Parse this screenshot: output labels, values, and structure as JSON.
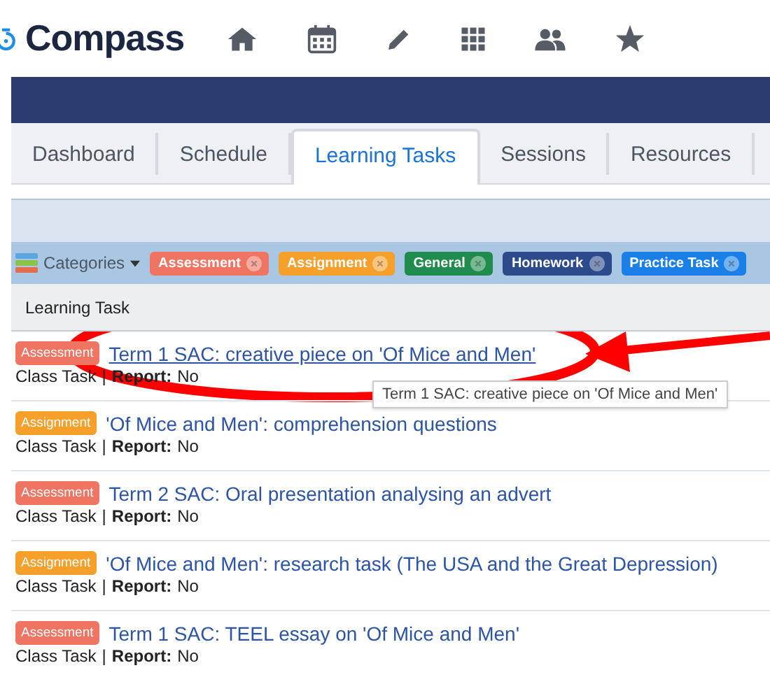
{
  "brand": {
    "name": "Compass"
  },
  "nav_icons": [
    {
      "kind": "home"
    },
    {
      "kind": "calendar"
    },
    {
      "kind": "pencil"
    },
    {
      "kind": "grid"
    },
    {
      "kind": "people"
    },
    {
      "kind": "star"
    }
  ],
  "tabs": [
    {
      "label": "Dashboard",
      "selected": false
    },
    {
      "label": "Schedule",
      "selected": false
    },
    {
      "label": "Learning Tasks",
      "selected": true
    },
    {
      "label": "Sessions",
      "selected": false
    },
    {
      "label": "Resources",
      "selected": false
    }
  ],
  "filter": {
    "label": "Categories",
    "tags": [
      {
        "label": "Assessment",
        "color": "#ef7462"
      },
      {
        "label": "Assignment",
        "color": "#f6a02c"
      },
      {
        "label": "General",
        "color": "#1f8b4c"
      },
      {
        "label": "Homework",
        "color": "#2d4a8c"
      },
      {
        "label": "Practice Task",
        "color": "#1a7fe6"
      }
    ]
  },
  "table": {
    "column": "Learning Task",
    "rows": [
      {
        "category": "Assessment",
        "color": "#ef7462",
        "title": "Term 1 SAC: creative piece on 'Of Mice and Men'",
        "type": "Class Task",
        "separator": "|",
        "report_label": "Report:",
        "report": "No",
        "hovered": true
      },
      {
        "category": "Assignment",
        "color": "#f6a02c",
        "title": "'Of Mice and Men': comprehension questions",
        "type": "Class Task",
        "separator": "|",
        "report_label": "Report:",
        "report": "No",
        "hovered": false
      },
      {
        "category": "Assessment",
        "color": "#ef7462",
        "title": "Term 2 SAC: Oral presentation analysing an advert",
        "type": "Class Task",
        "separator": "|",
        "report_label": "Report:",
        "report": "No",
        "hovered": false
      },
      {
        "category": "Assignment",
        "color": "#f6a02c",
        "title": "'Of Mice and Men': research task (The USA and the Great Depression)",
        "type": "Class Task",
        "separator": "|",
        "report_label": "Report:",
        "report": "No",
        "hovered": false
      },
      {
        "category": "Assessment",
        "color": "#ef7462",
        "title": "Term 1 SAC: TEEL essay on 'Of Mice and Men'",
        "type": "Class Task",
        "separator": "|",
        "report_label": "Report:",
        "report": "No",
        "hovered": false
      }
    ]
  },
  "tooltip": {
    "text": "Term 1 SAC: creative piece on 'Of Mice and Men'"
  },
  "annotation": {
    "kind": "circle-arrow"
  }
}
